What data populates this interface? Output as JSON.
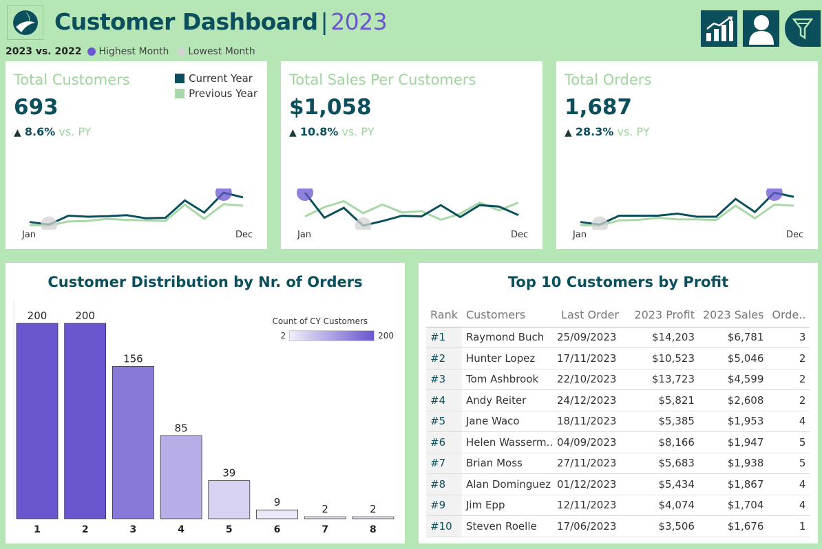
{
  "header": {
    "title": "Customer Dashboard",
    "separator": "|",
    "year": "2023",
    "icons": [
      "chart-growth-icon",
      "user-icon",
      "filter-icon"
    ]
  },
  "legend": {
    "comparison": "2023 vs. 2022",
    "highest": "Highest Month",
    "lowest": "Lowest Month",
    "highest_color": "#6a56cf",
    "lowest_color": "#d3d3d3"
  },
  "colors": {
    "current": "#0b4f5c",
    "previous": "#a8d8a8",
    "accent": "#6a56cf",
    "background": "#b6e6b6"
  },
  "kpis": [
    {
      "title": "Total Customers",
      "value": "693",
      "arrow": "▲",
      "pct": "8.6%",
      "vs": "vs. PY",
      "x_start": "Jan",
      "x_end": "Dec",
      "show_legend": true,
      "current": [
        39,
        34,
        51,
        49,
        50,
        52,
        46,
        47,
        80,
        57,
        95,
        86
      ],
      "previous": [
        33,
        32,
        40,
        41,
        45,
        43,
        42,
        41,
        72,
        45,
        73,
        70
      ],
      "max_index": 10,
      "min_index": 1
    },
    {
      "title": "Total Sales Per Customers",
      "value": "$1,058",
      "arrow": "▲",
      "pct": "10.8%",
      "vs": "vs. PY",
      "x_start": "Jan",
      "x_end": "Dec",
      "show_legend": false,
      "current": [
        99,
        61,
        76,
        49,
        56,
        64,
        63,
        80,
        62,
        80,
        78,
        65
      ],
      "previous": [
        63,
        77,
        86,
        68,
        81,
        69,
        71,
        58,
        67,
        84,
        72,
        84
      ],
      "max_index": 0,
      "min_index": 3
    },
    {
      "title": "Total Orders",
      "value": "1,687",
      "arrow": "▲",
      "pct": "28.3%",
      "vs": "vs. PY",
      "x_start": "Jan",
      "x_end": "Dec",
      "show_legend": false,
      "current": [
        40,
        35,
        52,
        52,
        52,
        56,
        50,
        50,
        84,
        59,
        96,
        88
      ],
      "previous": [
        34,
        33,
        43,
        44,
        48,
        45,
        45,
        44,
        71,
        47,
        73,
        71
      ],
      "max_index": 10,
      "min_index": 1
    }
  ],
  "kpi_legend": {
    "current": "Current Year",
    "previous": "Previous Year"
  },
  "distribution": {
    "title": "Customer Distribution by Nr. of Orders",
    "legend_title": "Count of CY Customers",
    "legend_min": "2",
    "legend_max": "200"
  },
  "chart_data": {
    "type": "bar",
    "title": "Customer Distribution by Nr. of Orders",
    "categories": [
      "1",
      "2",
      "3",
      "4",
      "5",
      "6",
      "7",
      "8"
    ],
    "values": [
      200,
      200,
      156,
      85,
      39,
      9,
      2,
      2
    ],
    "ylim": [
      0,
      200
    ],
    "color_scale": [
      "#f0eef9",
      "#6a56cf"
    ],
    "legend": "top-right"
  },
  "top10": {
    "title": "Top 10 Customers by Profit",
    "headers": [
      "Rank",
      "Customers",
      "Last Order",
      "2023 Profit",
      "2023 Sales",
      "Orde.."
    ],
    "rows": [
      [
        "#1",
        "Raymond Buch",
        "25/09/2023",
        "$14,203",
        "$6,781",
        "3"
      ],
      [
        "#2",
        "Hunter Lopez",
        "17/11/2023",
        "$10,523",
        "$5,046",
        "2"
      ],
      [
        "#3",
        "Tom Ashbrook",
        "22/10/2023",
        "$13,723",
        "$4,599",
        "2"
      ],
      [
        "#4",
        "Andy Reiter",
        "24/12/2023",
        "$5,821",
        "$2,608",
        "2"
      ],
      [
        "#5",
        "Jane Waco",
        "18/11/2023",
        "$5,385",
        "$1,953",
        "4"
      ],
      [
        "#6",
        "Helen Wasserm..",
        "04/09/2023",
        "$8,166",
        "$1,947",
        "5"
      ],
      [
        "#7",
        "Brian Moss",
        "27/11/2023",
        "$5,683",
        "$1,938",
        "5"
      ],
      [
        "#8",
        "Alan Dominguez",
        "01/12/2023",
        "$5,434",
        "$1,867",
        "4"
      ],
      [
        "#9",
        "Jim Epp",
        "12/11/2023",
        "$4,074",
        "$1,704",
        "4"
      ],
      [
        "#10",
        "Steven Roelle",
        "17/06/2023",
        "$3,506",
        "$1,676",
        "1"
      ]
    ]
  }
}
